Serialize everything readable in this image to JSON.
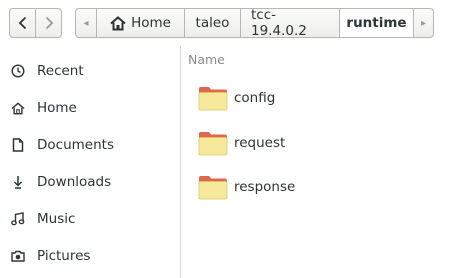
{
  "toolbar": {
    "back_icon": "chevron-left-icon",
    "forward_icon": "chevron-right-icon",
    "path_left_arrow": "◂",
    "path_right_arrow": "▸",
    "crumbs": [
      {
        "label": "Home",
        "icon": "home-icon"
      },
      {
        "label": "taleo"
      },
      {
        "label": "tcc-19.4.0.2"
      },
      {
        "label": "runtime",
        "active": true
      }
    ]
  },
  "sidebar": {
    "items": [
      {
        "label": "Recent",
        "icon": "clock-icon"
      },
      {
        "label": "Home",
        "icon": "home-icon"
      },
      {
        "label": "Documents",
        "icon": "document-icon"
      },
      {
        "label": "Downloads",
        "icon": "download-icon"
      },
      {
        "label": "Music",
        "icon": "music-icon"
      },
      {
        "label": "Pictures",
        "icon": "camera-icon"
      }
    ]
  },
  "main": {
    "column_header": "Name",
    "files": [
      {
        "name": "config",
        "type": "folder"
      },
      {
        "name": "request",
        "type": "folder"
      },
      {
        "name": "response",
        "type": "folder"
      }
    ]
  },
  "colors": {
    "folder_body": "#f7e99a",
    "folder_tab": "#e2674a",
    "border": "#b6b6b3",
    "text": "#2e3436",
    "header_text": "#8a8d8a"
  }
}
